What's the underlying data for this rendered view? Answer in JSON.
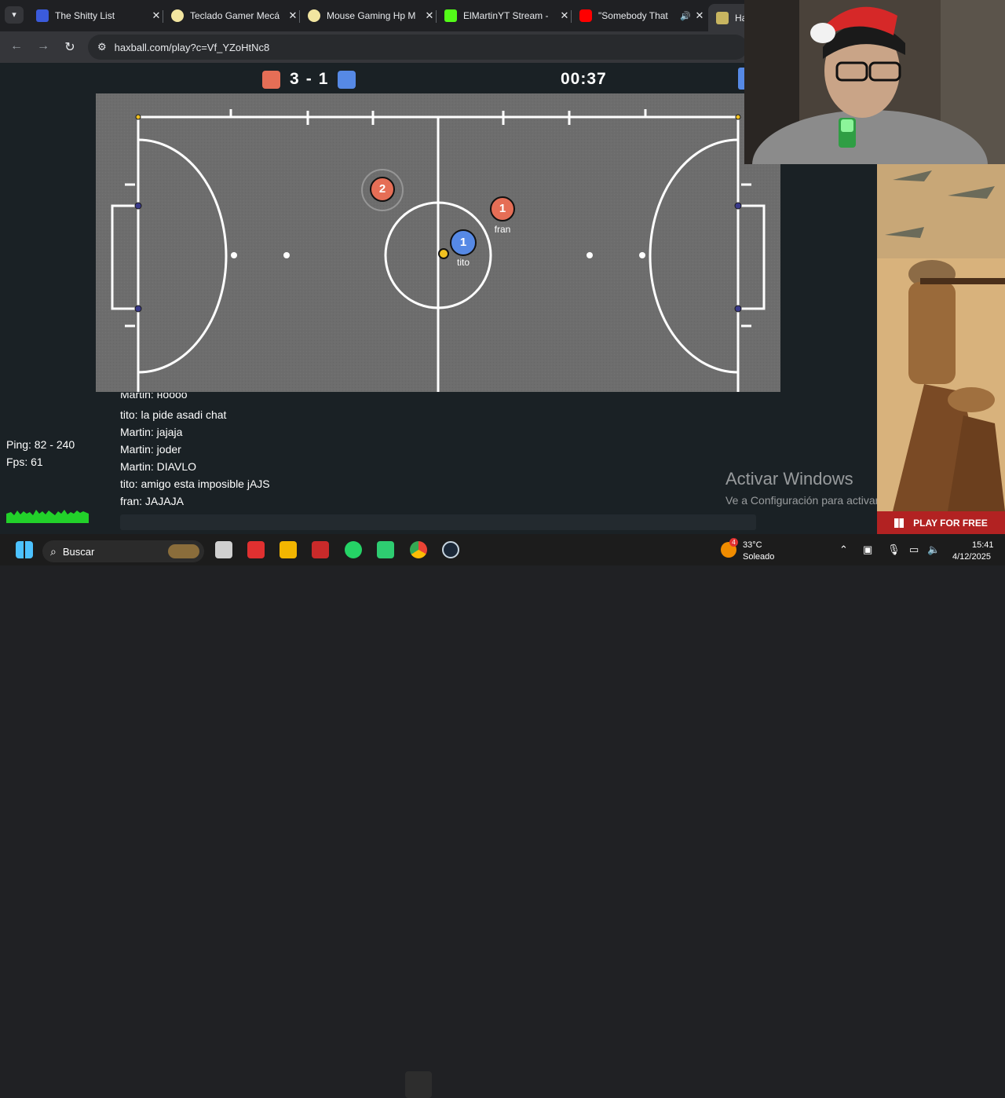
{
  "browser": {
    "tabs": [
      {
        "title": "The Shitty List",
        "fav_color": "#3b5bdb"
      },
      {
        "title": "Teclado Gamer Mecá",
        "fav_color": "#f2e5a0"
      },
      {
        "title": "Mouse Gaming Hp M",
        "fav_color": "#f2e5a0"
      },
      {
        "title": "ElMartinYT Stream - ",
        "fav_color": "#53fc18"
      },
      {
        "title": "\"Somebody That",
        "fav_color": "#ff0000"
      },
      {
        "title": "Ha",
        "fav_color": "#c8b560"
      }
    ],
    "tab_menu_icon": "chevron-down",
    "close_glyph": "✕",
    "audio_icon": "🔊",
    "url": "haxball.com/play?c=Vf_YZoHtNc8"
  },
  "game": {
    "score_red": "3",
    "score_blue": "1",
    "score_sep": "-",
    "timer": "00:37",
    "red_color": "#e56e56",
    "blue_color": "#5689e5",
    "players": [
      {
        "number": "2",
        "team": "red",
        "name": ""
      },
      {
        "number": "1",
        "team": "red",
        "name": "fran"
      },
      {
        "number": "1",
        "team": "blue",
        "name": "tito"
      }
    ]
  },
  "chat": {
    "partial_line": "Martin: ноооо",
    "lines": [
      "tito: la pide asadi chat",
      "Martin: jajaja",
      "Martin: joder",
      "Martin: DIAVLO",
      "tito: amigo esta imposible jAJS",
      "fran: JAJAJA"
    ]
  },
  "stats": {
    "ping": "Ping: 82 - 240",
    "fps": "Fps: 61"
  },
  "watermark": {
    "line1": "Activar Windows",
    "line2": "Ve a Configuración para activar Windows."
  },
  "ad": {
    "button_label": "PLAY FOR FREE"
  },
  "taskbar": {
    "search_placeholder": "Buscar",
    "weather_temp": "33°C",
    "weather_condition": "Soleado",
    "weather_badge": "4",
    "time": "15:41",
    "date": "4/12/2025"
  }
}
